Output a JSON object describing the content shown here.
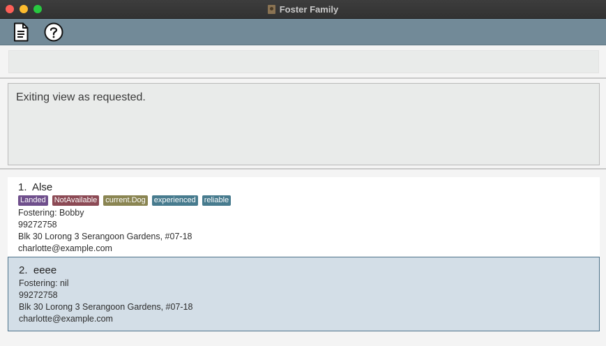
{
  "window": {
    "title": "Foster Family"
  },
  "command": {
    "value": "",
    "placeholder": ""
  },
  "result": {
    "message": "Exiting view as requested."
  },
  "persons": [
    {
      "index": "1.",
      "name": "Alse",
      "tags": [
        {
          "label": "Landed",
          "color": "#6f4f8c"
        },
        {
          "label": "NotAvailable",
          "color": "#8c4a55"
        },
        {
          "label": "current.Dog",
          "color": "#8a8552"
        },
        {
          "label": "experienced",
          "color": "#477b8e"
        },
        {
          "label": "reliable",
          "color": "#477b8e"
        }
      ],
      "fostering": "Fostering: Bobby",
      "phone": "99272758",
      "address": "Blk 30 Lorong 3 Serangoon Gardens, #07-18",
      "email": "charlotte@example.com"
    },
    {
      "index": "2.",
      "name": "eeee",
      "tags": [],
      "fostering": "Fostering: nil",
      "phone": "99272758",
      "address": "Blk 30 Lorong 3 Serangoon Gardens, #07-18",
      "email": "charlotte@example.com"
    }
  ]
}
